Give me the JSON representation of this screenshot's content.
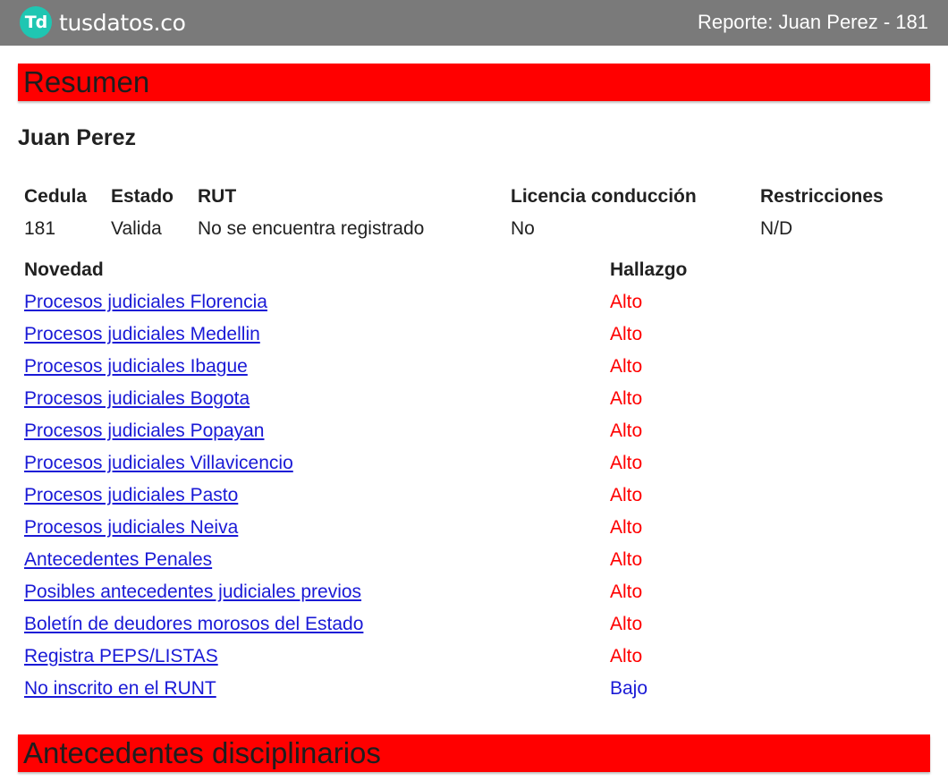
{
  "header": {
    "logo_mark": "Td",
    "logo_text": "tusdatos.co",
    "report_title": "Reporte: Juan Perez - 181"
  },
  "sections": {
    "resumen": "Resumen",
    "disciplinarios": "Antecedentes disciplinarios"
  },
  "person": {
    "name": "Juan Perez"
  },
  "info": {
    "headers": [
      "Cedula",
      "Estado",
      "RUT",
      "Licencia conducción",
      "Restricciones"
    ],
    "values": [
      "181",
      "Valida",
      "No se encuentra registrado",
      "No",
      "N/D"
    ]
  },
  "novedades": {
    "col_novedad": "Novedad",
    "col_hallazgo": "Hallazgo",
    "rows": [
      {
        "label": "Procesos judiciales Florencia",
        "level": "Alto"
      },
      {
        "label": "Procesos judiciales Medellin",
        "level": "Alto"
      },
      {
        "label": "Procesos judiciales Ibague",
        "level": "Alto"
      },
      {
        "label": "Procesos judiciales Bogota",
        "level": "Alto"
      },
      {
        "label": "Procesos judiciales Popayan",
        "level": "Alto"
      },
      {
        "label": "Procesos judiciales Villavicencio",
        "level": "Alto"
      },
      {
        "label": "Procesos judiciales Pasto",
        "level": "Alto"
      },
      {
        "label": "Procesos judiciales Neiva",
        "level": "Alto"
      },
      {
        "label": "Antecedentes Penales",
        "level": "Alto"
      },
      {
        "label": "Posibles antecedentes judiciales previos",
        "level": "Alto"
      },
      {
        "label": "Boletín de deudores morosos del Estado",
        "level": "Alto"
      },
      {
        "label": "Registra PEPS/LISTAS",
        "level": "Alto"
      },
      {
        "label": "No inscrito en el RUNT",
        "level": "Bajo"
      }
    ]
  },
  "colors": {
    "topbar": "#7a7a7a",
    "logo_accent": "#1fc6b2",
    "section_bar": "#ff0000",
    "link": "#1a1ad6",
    "level_alto": "#ff0000",
    "level_bajo": "#1a1ad6"
  }
}
